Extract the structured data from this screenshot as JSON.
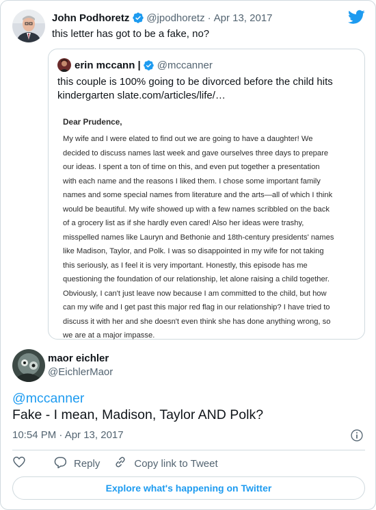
{
  "parent_tweet": {
    "author_name": "John Podhoretz",
    "handle": "@jpodhoretz",
    "separator": "·",
    "date": "Apr 13, 2017",
    "text": "this letter has got to be a fake, no?"
  },
  "quoted_tweet": {
    "author_name": "erin mccann |",
    "handle": "@mccanner",
    "text_line1": "this couple is 100% going to be divorced before the child hits",
    "text_line2": "kindergarten slate.com/articles/life/…",
    "letter": {
      "greeting": "Dear Prudence,",
      "lines": [
        "My wife and I were elated to find out we are going to have a daughter! We",
        "decided to discuss names last week and gave ourselves three days to prepare",
        "our ideas. I spent a ton of time on this, and even put together a presentation",
        "with each name and the reasons I liked them. I chose some important family",
        "names and some special names from literature and the arts—all of which I think",
        "would be beautiful. My wife showed up with a few names scribbled on the back",
        "of a grocery list as if she hardly even cared! Also her ideas were trashy,",
        "misspelled names like Lauryn and Bethonie and 18th-century presidents' names",
        "like Madison, Taylor, and Polk. I was so disappointed in my wife for not taking",
        "this seriously, as I feel it is very important. Honestly, this episode has me",
        "questioning the foundation of our relationship, let alone raising a child together.",
        "Obviously, I can't just leave now because I am committed to the child, but how",
        "can my wife and I get past this major red flag in our relationship? I have tried to",
        "discuss it with her and she doesn't even think she has done anything wrong, so",
        "we are at a major impasse."
      ]
    }
  },
  "reply_tweet": {
    "author_name": "maor eichler",
    "handle": "@EichlerMaor",
    "mention": "@mccanner",
    "text": "Fake - I mean, Madison, Taylor AND Polk?",
    "timestamp": "10:54 PM · Apr 13, 2017"
  },
  "actions": {
    "like_icon": "heart-icon",
    "reply_label": "Reply",
    "copy_link_label": "Copy link to Tweet"
  },
  "explore_label": "Explore what's happening on Twitter",
  "colors": {
    "accent": "#1d9bf0",
    "secondary_text": "#536471",
    "border": "#cfd9de"
  }
}
